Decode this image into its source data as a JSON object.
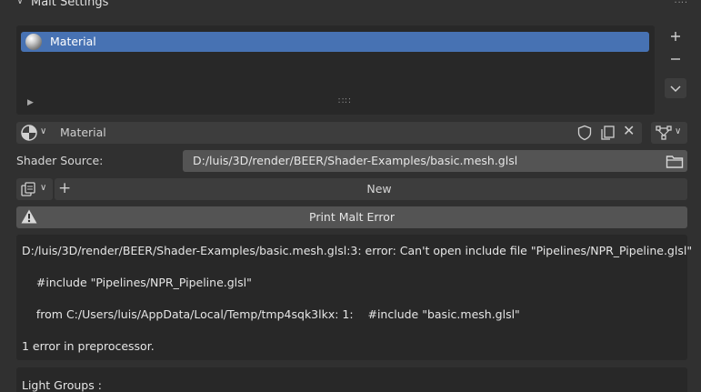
{
  "panel": {
    "title": "Malt Settings"
  },
  "material_slots": {
    "items": [
      {
        "label": "Material"
      }
    ],
    "add_icon": "plus-icon",
    "remove_icon": "minus-icon",
    "specials_icon": "chevron-down-icon"
  },
  "material_selector": {
    "value": "Material"
  },
  "shader_source": {
    "label": "Shader Source:",
    "value": "D:/luis/3D/render/BEER/Shader-Examples/basic.mesh.glsl"
  },
  "new_button": {
    "label": "New"
  },
  "print_error_button": {
    "label": "Print Malt Error"
  },
  "error_log": {
    "lines": [
      "D:/luis/3D/render/BEER/Shader-Examples/basic.mesh.glsl:3: error: Can't open include file \"Pipelines/NPR_Pipeline.glsl\"",
      "    #include \"Pipelines/NPR_Pipeline.glsl\"",
      "    from C:/Users/luis/AppData/Local/Temp/tmp4sqk3lkx: 1:    #include \"basic.mesh.glsl\"",
      "1 error in preprocessor."
    ]
  },
  "light_groups": {
    "label": "Light Groups :"
  },
  "colors": {
    "selection": "#4772b3",
    "background": "#303030",
    "field": "#545454",
    "button": "#3d3d3d",
    "list": "#282828"
  }
}
